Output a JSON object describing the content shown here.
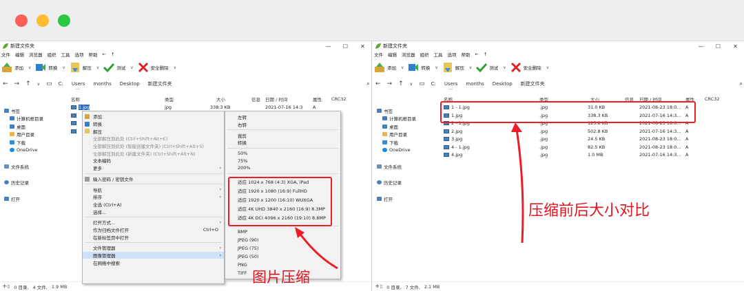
{
  "colors": {
    "accent_red": "#ee1c25",
    "selection": "#cfe1f6"
  },
  "left": {
    "title": "新建文件夹",
    "window_controls": [
      "—",
      "☐",
      "✕"
    ],
    "menu": [
      "文件",
      "编辑",
      "浏览器",
      "组织",
      "工具",
      "选项",
      "帮助",
      "←",
      "↑"
    ],
    "toolbar": [
      "添加",
      "转换",
      "解压",
      "测试",
      "安全删除"
    ],
    "path": [
      "C:",
      "Users",
      "months",
      "Desktop",
      "新建文件夹"
    ],
    "sidebar": [
      "书签",
      "计算机根目录",
      "桌面",
      "用户目录",
      "下载",
      "OneDrive",
      "文件系统",
      "历史记录",
      "打开"
    ],
    "headers": {
      "name": "名称",
      "type": "类型",
      "size": "大小",
      "info": "信息",
      "date": "日期 / 时间",
      "attr": "属性",
      "crc": "CRC32",
      "more": "···"
    },
    "rows": [
      {
        "name": "1.jpg",
        "type": "jpg",
        "size": "338.3 KB",
        "date": "2021-07-16 14:3",
        "attr": "A"
      }
    ],
    "status": [
      "0 目录,",
      "4 文件,",
      "1.9 MB"
    ],
    "context_menu": [
      "添加",
      "转换",
      "解压",
      "全部解压到此处 (Ctrl+Shift+Alt+E)",
      "全部解压到此处 (智能创建文件夹) (Ctrl+Shift+Alt+S)",
      "全部解压到此处 (新建文件夹) (Ctrl+Shift+Alt+N)",
      "文本编码",
      "更多",
      "输入密码 / 密钥文件",
      "导航",
      "排序",
      "全选 (Ctrl+A)",
      "选择...",
      "打开方式...",
      "作为归档文件打开",
      "Ctrl+O",
      "在新标签页中打开",
      "文件管理器",
      "图像管理器",
      "在网络中搜索"
    ],
    "submenu": [
      "左转",
      "右转",
      "裁剪",
      "转换",
      "50%",
      "75%",
      "200%",
      "适应 1024 x 768 (4:3) XGA, iPad",
      "适应 1920 x 1080 (16:9) FullHD",
      "适应 1920 x 1200 (16:10) WUXGA",
      "适应 4K UHD 3840 x 2160 (16:9) 8.3MP",
      "适应 4K DCI 4096 x 2160 (19:10) 8.8MP",
      "BMP",
      "JPEG (90)",
      "JPEG (75)",
      "JPEG (50)",
      "PNG",
      "TIFF"
    ],
    "annotation": "图片压缩"
  },
  "right": {
    "title": "新建文件夹",
    "status": [
      "0 目录,",
      "7 文件,",
      "2.1 MB"
    ],
    "rows": [
      {
        "name": "1 - 1.jpg",
        "type": ".jpg",
        "size": "31.0 KB",
        "date": "2021-08-23 18:0...",
        "attr": "A"
      },
      {
        "name": "1.jpg",
        "type": ".jpg",
        "size": "338.3 KB",
        "date": "2021-07-16 14:3...",
        "attr": "A"
      },
      {
        "name": "2 - 1.jpg",
        "type": ".jpg",
        "size": "125.8 KB",
        "date": "2021-08-23 18:0...",
        "attr": "A"
      },
      {
        "name": "2.jpg",
        "type": ".jpg",
        "size": "502.8 KB",
        "date": "2021-07-16 14:3...",
        "attr": "A"
      },
      {
        "name": "3.jpg",
        "type": ".jpg",
        "size": "24.5 KB",
        "date": "2021-08-23 18:0...",
        "attr": "A"
      },
      {
        "name": "4 - 1.jpg",
        "type": ".jpg",
        "size": "82.5 KB",
        "date": "2021-08-23 18:0...",
        "attr": "A"
      },
      {
        "name": "4.jpg",
        "type": ".jpg",
        "size": "1.0 MB",
        "date": "2021-07-16 14:3...",
        "attr": "A"
      }
    ],
    "annotation": "压缩前后大小对比"
  }
}
